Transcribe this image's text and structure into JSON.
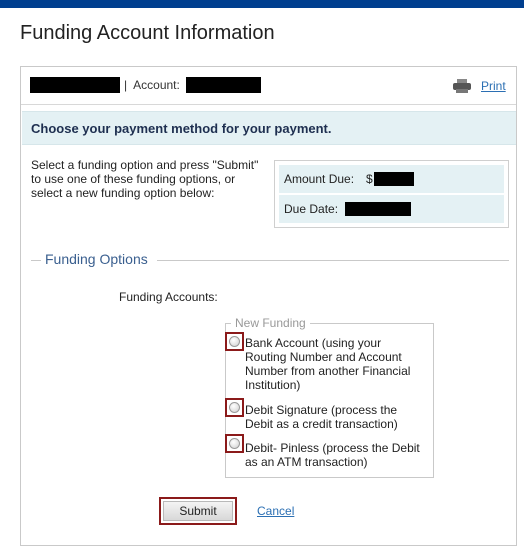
{
  "page": {
    "title": "Funding Account Information"
  },
  "account_row": {
    "separator": "|",
    "account_label": "Account:",
    "print_label": "Print",
    "print_icon": "printer-icon"
  },
  "banner": {
    "text": "Choose your payment method for your payment."
  },
  "instructions": "Select a funding option and press \"Submit\" to use one of these funding options, or select a new funding option below:",
  "amount_box": {
    "amount_due_label": "Amount Due:",
    "currency_symbol": "$",
    "due_date_label": "Due Date:"
  },
  "funding_options": {
    "legend": "Funding Options",
    "accounts_label": "Funding Accounts:",
    "new_funding_legend": "New Funding",
    "options": [
      {
        "label": "Bank Account (using your Routing Number and Account Number from another Financial Institution)",
        "selected": false
      },
      {
        "label": "Debit Signature (process the Debit as a credit transaction)",
        "selected": false
      },
      {
        "label": "Debit- Pinless (process the Debit as an ATM transaction)",
        "selected": false
      }
    ]
  },
  "actions": {
    "submit_label": "Submit",
    "cancel_label": "Cancel"
  },
  "colors": {
    "top_bar": "#003f8f",
    "banner_bg": "#e4f1f4",
    "link": "#2b6fb3",
    "highlight_border": "#8b1a1a"
  }
}
